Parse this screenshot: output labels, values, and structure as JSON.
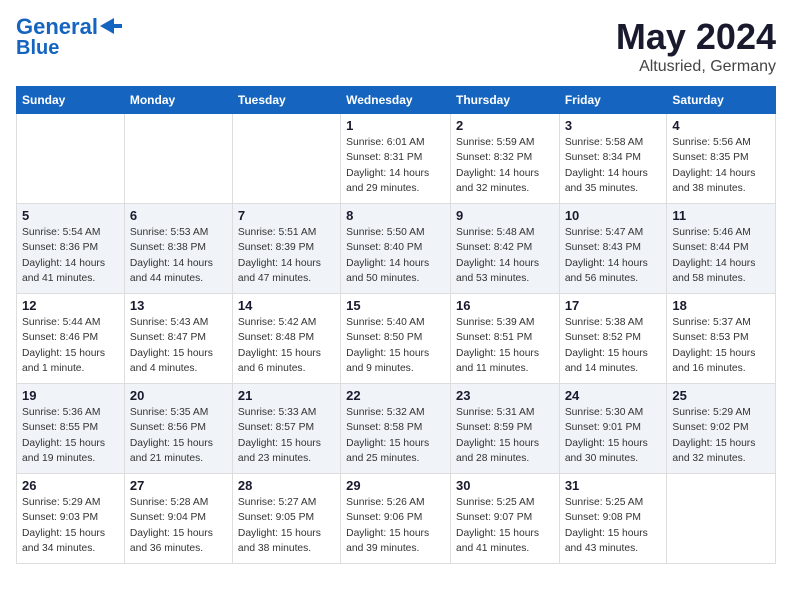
{
  "header": {
    "logo_line1": "General",
    "logo_line2": "Blue",
    "month": "May 2024",
    "location": "Altusried, Germany"
  },
  "weekdays": [
    "Sunday",
    "Monday",
    "Tuesday",
    "Wednesday",
    "Thursday",
    "Friday",
    "Saturday"
  ],
  "weeks": [
    [
      {
        "day": "",
        "info": ""
      },
      {
        "day": "",
        "info": ""
      },
      {
        "day": "",
        "info": ""
      },
      {
        "day": "1",
        "info": "Sunrise: 6:01 AM\nSunset: 8:31 PM\nDaylight: 14 hours and 29 minutes."
      },
      {
        "day": "2",
        "info": "Sunrise: 5:59 AM\nSunset: 8:32 PM\nDaylight: 14 hours and 32 minutes."
      },
      {
        "day": "3",
        "info": "Sunrise: 5:58 AM\nSunset: 8:34 PM\nDaylight: 14 hours and 35 minutes."
      },
      {
        "day": "4",
        "info": "Sunrise: 5:56 AM\nSunset: 8:35 PM\nDaylight: 14 hours and 38 minutes."
      }
    ],
    [
      {
        "day": "5",
        "info": "Sunrise: 5:54 AM\nSunset: 8:36 PM\nDaylight: 14 hours and 41 minutes."
      },
      {
        "day": "6",
        "info": "Sunrise: 5:53 AM\nSunset: 8:38 PM\nDaylight: 14 hours and 44 minutes."
      },
      {
        "day": "7",
        "info": "Sunrise: 5:51 AM\nSunset: 8:39 PM\nDaylight: 14 hours and 47 minutes."
      },
      {
        "day": "8",
        "info": "Sunrise: 5:50 AM\nSunset: 8:40 PM\nDaylight: 14 hours and 50 minutes."
      },
      {
        "day": "9",
        "info": "Sunrise: 5:48 AM\nSunset: 8:42 PM\nDaylight: 14 hours and 53 minutes."
      },
      {
        "day": "10",
        "info": "Sunrise: 5:47 AM\nSunset: 8:43 PM\nDaylight: 14 hours and 56 minutes."
      },
      {
        "day": "11",
        "info": "Sunrise: 5:46 AM\nSunset: 8:44 PM\nDaylight: 14 hours and 58 minutes."
      }
    ],
    [
      {
        "day": "12",
        "info": "Sunrise: 5:44 AM\nSunset: 8:46 PM\nDaylight: 15 hours and 1 minute."
      },
      {
        "day": "13",
        "info": "Sunrise: 5:43 AM\nSunset: 8:47 PM\nDaylight: 15 hours and 4 minutes."
      },
      {
        "day": "14",
        "info": "Sunrise: 5:42 AM\nSunset: 8:48 PM\nDaylight: 15 hours and 6 minutes."
      },
      {
        "day": "15",
        "info": "Sunrise: 5:40 AM\nSunset: 8:50 PM\nDaylight: 15 hours and 9 minutes."
      },
      {
        "day": "16",
        "info": "Sunrise: 5:39 AM\nSunset: 8:51 PM\nDaylight: 15 hours and 11 minutes."
      },
      {
        "day": "17",
        "info": "Sunrise: 5:38 AM\nSunset: 8:52 PM\nDaylight: 15 hours and 14 minutes."
      },
      {
        "day": "18",
        "info": "Sunrise: 5:37 AM\nSunset: 8:53 PM\nDaylight: 15 hours and 16 minutes."
      }
    ],
    [
      {
        "day": "19",
        "info": "Sunrise: 5:36 AM\nSunset: 8:55 PM\nDaylight: 15 hours and 19 minutes."
      },
      {
        "day": "20",
        "info": "Sunrise: 5:35 AM\nSunset: 8:56 PM\nDaylight: 15 hours and 21 minutes."
      },
      {
        "day": "21",
        "info": "Sunrise: 5:33 AM\nSunset: 8:57 PM\nDaylight: 15 hours and 23 minutes."
      },
      {
        "day": "22",
        "info": "Sunrise: 5:32 AM\nSunset: 8:58 PM\nDaylight: 15 hours and 25 minutes."
      },
      {
        "day": "23",
        "info": "Sunrise: 5:31 AM\nSunset: 8:59 PM\nDaylight: 15 hours and 28 minutes."
      },
      {
        "day": "24",
        "info": "Sunrise: 5:30 AM\nSunset: 9:01 PM\nDaylight: 15 hours and 30 minutes."
      },
      {
        "day": "25",
        "info": "Sunrise: 5:29 AM\nSunset: 9:02 PM\nDaylight: 15 hours and 32 minutes."
      }
    ],
    [
      {
        "day": "26",
        "info": "Sunrise: 5:29 AM\nSunset: 9:03 PM\nDaylight: 15 hours and 34 minutes."
      },
      {
        "day": "27",
        "info": "Sunrise: 5:28 AM\nSunset: 9:04 PM\nDaylight: 15 hours and 36 minutes."
      },
      {
        "day": "28",
        "info": "Sunrise: 5:27 AM\nSunset: 9:05 PM\nDaylight: 15 hours and 38 minutes."
      },
      {
        "day": "29",
        "info": "Sunrise: 5:26 AM\nSunset: 9:06 PM\nDaylight: 15 hours and 39 minutes."
      },
      {
        "day": "30",
        "info": "Sunrise: 5:25 AM\nSunset: 9:07 PM\nDaylight: 15 hours and 41 minutes."
      },
      {
        "day": "31",
        "info": "Sunrise: 5:25 AM\nSunset: 9:08 PM\nDaylight: 15 hours and 43 minutes."
      },
      {
        "day": "",
        "info": ""
      }
    ]
  ]
}
